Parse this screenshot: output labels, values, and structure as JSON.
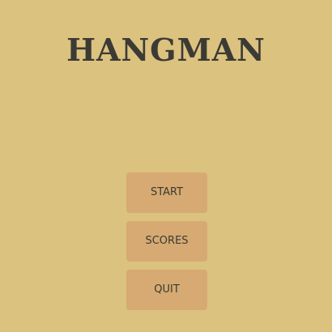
{
  "title": "HANGMAN",
  "menu": {
    "start_label": "START",
    "scores_label": "SCORES",
    "quit_label": "QUIT"
  },
  "colors": {
    "background": "#dcc27f",
    "button": "#d6aa72",
    "text": "#3b3a34"
  }
}
